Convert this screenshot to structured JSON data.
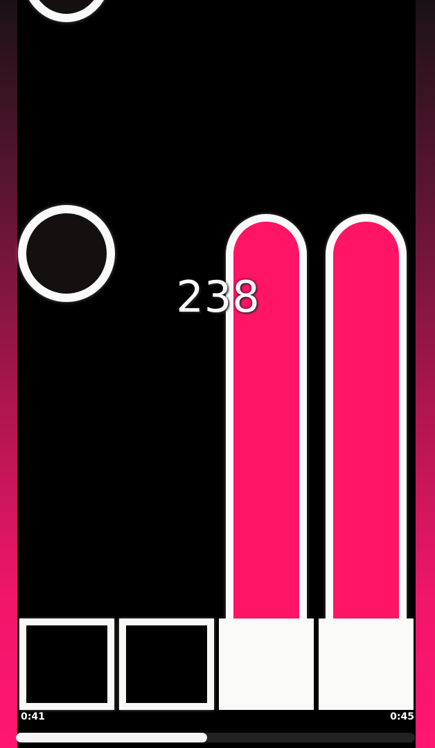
{
  "game": {
    "score": "238",
    "lanes": [
      {
        "key": "lane-1",
        "state": "idle"
      },
      {
        "key": "lane-2",
        "state": "idle"
      },
      {
        "key": "lane-3",
        "state": "pressed"
      },
      {
        "key": "lane-4",
        "state": "pressed"
      }
    ],
    "notes": [
      {
        "type": "tap",
        "lane": 1,
        "color": "#141010"
      },
      {
        "type": "tap",
        "lane": 1,
        "color": "#141010"
      },
      {
        "type": "hold",
        "lane": 3,
        "color": "#ff1466"
      },
      {
        "type": "hold",
        "lane": 4,
        "color": "#ff1466"
      }
    ]
  },
  "playback": {
    "elapsed": "0:41",
    "total": "0:45",
    "progress": 0.48
  },
  "colors": {
    "accent": "#ff1466",
    "background": "#000000",
    "key_outline": "#f7f7f5"
  }
}
